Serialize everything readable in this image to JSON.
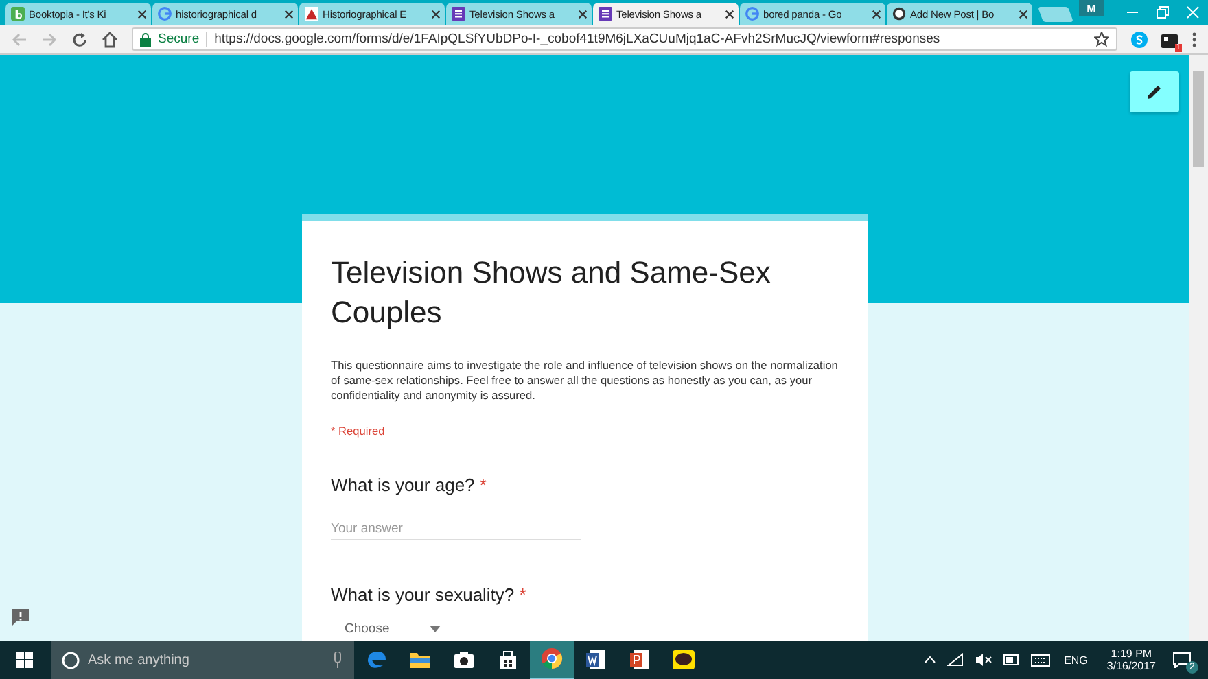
{
  "browser": {
    "tabs": [
      {
        "title": "Booktopia - It's Ki",
        "selected": false
      },
      {
        "title": "historiographical d",
        "selected": false
      },
      {
        "title": "Historiographical E",
        "selected": false
      },
      {
        "title": "Television Shows a",
        "selected": false
      },
      {
        "title": "Television Shows a",
        "selected": true
      },
      {
        "title": "bored panda - Go",
        "selected": false
      },
      {
        "title": "Add New Post | Bo",
        "selected": false
      }
    ],
    "profile": "M",
    "secure_label": "Secure",
    "url": "https://docs.google.com/forms/d/e/1FAIpQLSfYUbDPo-I-_cobof41t9M6jLXaCUuMjq1aC-AFvh2SrMucJQ/viewform#responses",
    "extension_badge": "1"
  },
  "form": {
    "title": "Television Shows and Same-Sex Couples",
    "description": "This questionnaire aims to investigate the role and influence of television shows on the normalization of same-sex relationships. Feel free to answer all the questions as honestly as you can, as your confidentiality and anonymity is assured.",
    "required_note": "* Required",
    "questions": [
      {
        "kind": "text",
        "label": "What is your age?",
        "required_mark": "*",
        "placeholder": "Your answer"
      },
      {
        "kind": "dropdown",
        "label": "What is your sexuality?",
        "required_mark": "*",
        "value": "Choose"
      }
    ]
  },
  "taskbar": {
    "search_placeholder": "Ask me anything",
    "apps": [
      {
        "selected": false
      },
      {
        "selected": false
      },
      {
        "selected": false
      },
      {
        "selected": false
      },
      {
        "selected": true
      },
      {
        "selected": false
      },
      {
        "selected": false
      },
      {
        "selected": false
      }
    ],
    "language": "ENG",
    "time": "1:19 PM",
    "date": "3/16/2017",
    "notifications": "2"
  }
}
